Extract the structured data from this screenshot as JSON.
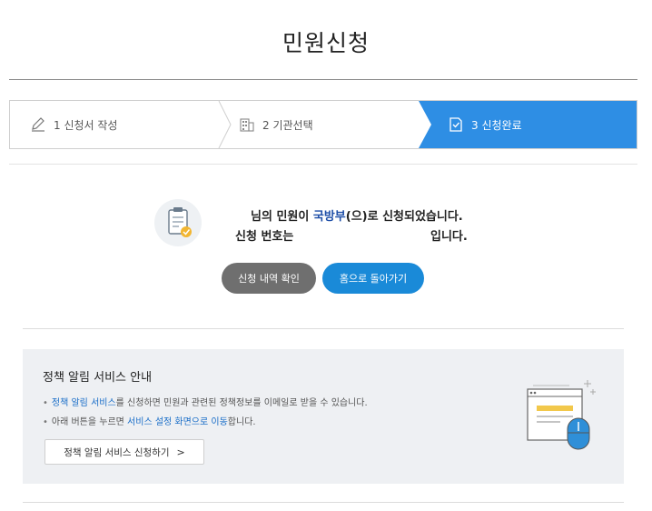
{
  "page": {
    "title": "민원신청"
  },
  "steps": [
    {
      "label": "1 신청서 작성",
      "icon": "pencil-icon"
    },
    {
      "label": "2 기관선택",
      "icon": "building-icon"
    },
    {
      "label": "3 신청완료",
      "icon": "document-check-icon"
    }
  ],
  "colors": {
    "active_step": "#2e8ee4",
    "primary_button": "#1a8ad8",
    "secondary_button": "#6f6f6f",
    "notice_bg": "#eef0f3",
    "ministry_text": "#1f4fa8"
  },
  "result": {
    "icon": "clipboard-check-icon",
    "line1_prefix": "님의 민원이 ",
    "ministry": "국방부",
    "line1_suffix": "(으)로 신청되었습니다.",
    "line2_prefix": "신청 번호는",
    "line2_suffix": "입니다."
  },
  "buttons": {
    "view_history": "신청 내역 확인",
    "go_home": "홈으로 돌아가기"
  },
  "notice": {
    "title": "정책 알림 서비스 안내",
    "bullet1_link": "정책 알림 서비스",
    "bullet1_rest": "를 신청하면 민원과 관련된 정책정보를 이메일로 받을 수 있습니다.",
    "bullet2_pre": "아래 버튼을 누르면 ",
    "bullet2_link": "서비스 설정 화면으로 이동",
    "bullet2_post": "합니다.",
    "subscribe_button": "정책 알림 서비스 신청하기",
    "illustration": "browser-window-mouse-icon"
  }
}
